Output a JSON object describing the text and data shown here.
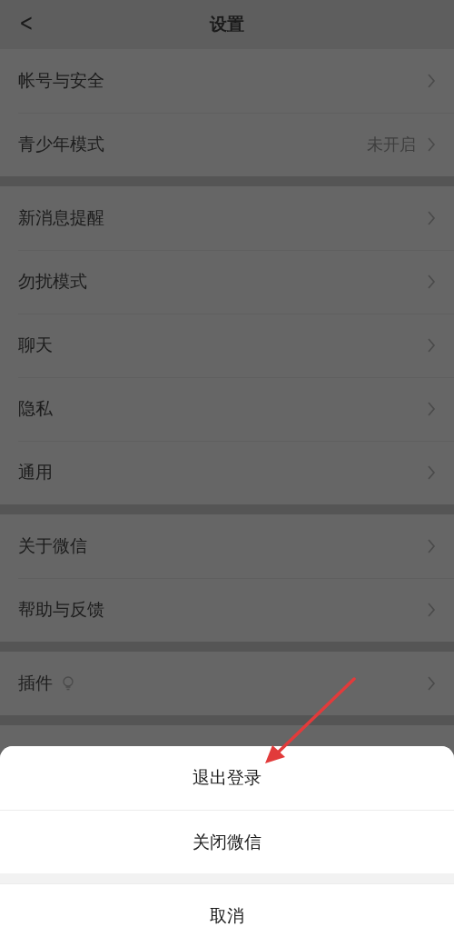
{
  "nav_bar": {
    "back": "<",
    "title": "设置"
  },
  "groups": [
    {
      "items": [
        {
          "label": "帐号与安全"
        },
        {
          "label": "青少年模式",
          "value": "未开启"
        }
      ]
    },
    {
      "items": [
        {
          "label": "新消息提醒"
        },
        {
          "label": "勿扰模式"
        },
        {
          "label": "聊天"
        },
        {
          "label": "隐私"
        },
        {
          "label": "通用"
        }
      ]
    },
    {
      "items": [
        {
          "label": "关于微信"
        },
        {
          "label": "帮助与反馈"
        }
      ]
    },
    {
      "items": [
        {
          "label": "插件",
          "has_icon": true
        }
      ]
    }
  ],
  "action_sheet": {
    "actions": [
      {
        "label": "退出登录"
      },
      {
        "label": "关闭微信"
      }
    ],
    "cancel": "取消"
  },
  "annotations": [
    {
      "kind": "arrow"
    }
  ]
}
